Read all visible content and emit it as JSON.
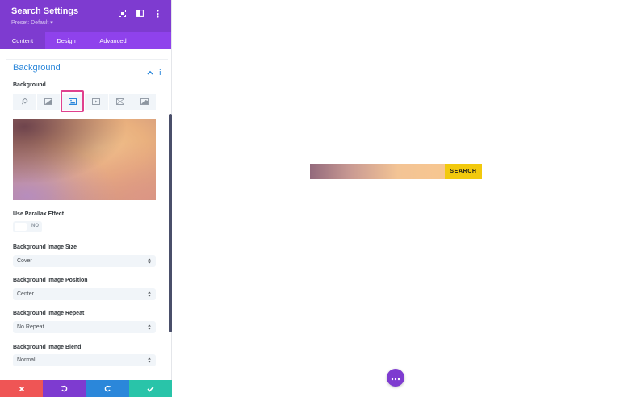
{
  "panel": {
    "title": "Search Settings",
    "preset": "Preset: Default ▾",
    "tabs": [
      {
        "label": "Content",
        "active": true
      },
      {
        "label": "Design",
        "active": false
      },
      {
        "label": "Advanced",
        "active": false
      }
    ],
    "section": {
      "title": "Background",
      "background_label": "Background",
      "background_types": [
        "color-icon",
        "gradient-icon",
        "image-icon",
        "video-icon",
        "pattern-icon",
        "mask-icon"
      ],
      "selected_type": "image-icon",
      "parallax_label": "Use Parallax Effect",
      "parallax_value": "NO",
      "size_label": "Background Image Size",
      "size_value": "Cover",
      "position_label": "Background Image Position",
      "position_value": "Center",
      "repeat_label": "Background Image Repeat",
      "repeat_value": "No Repeat",
      "blend_label": "Background Image Blend",
      "blend_value": "Normal"
    },
    "footer_icons": [
      "close-icon",
      "undo-icon",
      "redo-icon",
      "check-icon"
    ]
  },
  "canvas": {
    "search_button_label": "SEARCH"
  },
  "colors": {
    "header": "#7e3bd0",
    "tabs": "#8f42ec",
    "accent_blue": "#2b87da",
    "highlight": "#e0418e",
    "cancel": "#ef5555",
    "save": "#29c4a9",
    "search_button": "#f2c90d"
  }
}
